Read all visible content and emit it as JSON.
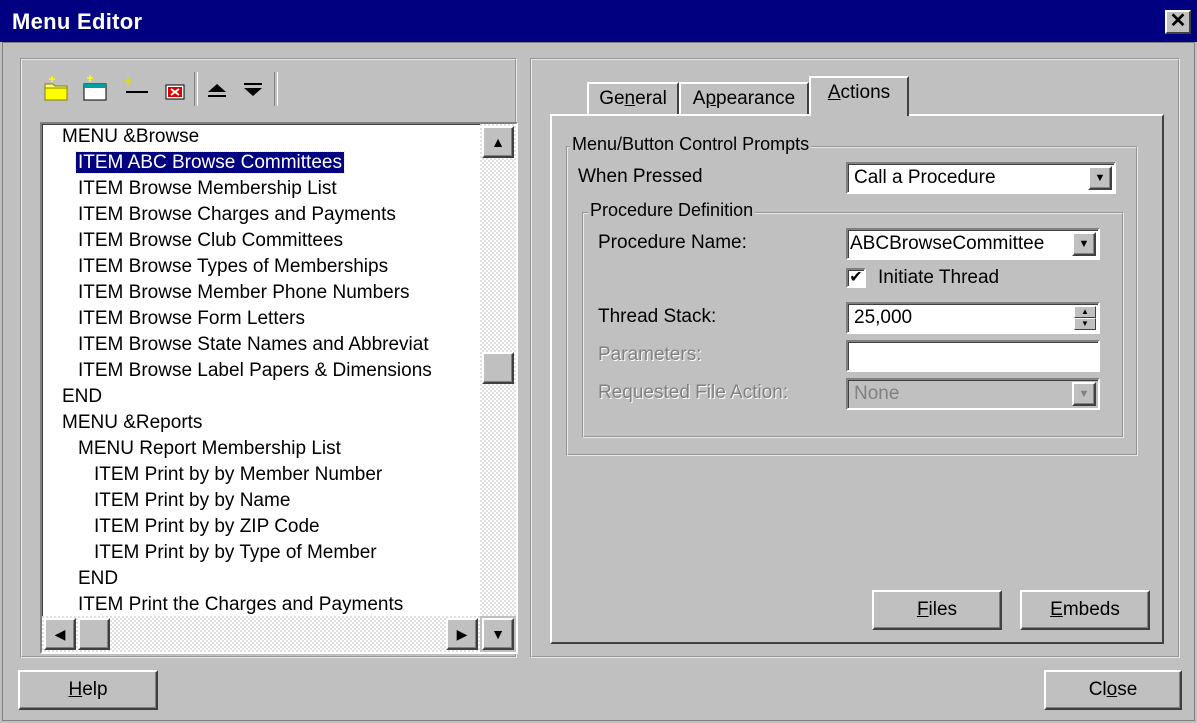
{
  "window": {
    "title": "Menu Editor",
    "close_glyph": "✕"
  },
  "toolbar": {
    "icons": [
      "new-menu-icon",
      "new-item-icon",
      "new-separator-icon",
      "delete-icon",
      "move-up-icon",
      "move-down-icon"
    ]
  },
  "tree": {
    "lines": [
      {
        "indent": 0,
        "text": "MENU  &Browse"
      },
      {
        "indent": 1,
        "text": "ITEM  ABC Browse Committees",
        "selected": true
      },
      {
        "indent": 1,
        "text": "ITEM  Browse Membership List"
      },
      {
        "indent": 1,
        "text": "ITEM  Browse Charges and Payments"
      },
      {
        "indent": 1,
        "text": "ITEM  Browse Club Committees"
      },
      {
        "indent": 1,
        "text": "ITEM  Browse Types of Memberships"
      },
      {
        "indent": 1,
        "text": "ITEM  Browse Member Phone Numbers"
      },
      {
        "indent": 1,
        "text": "ITEM  Browse Form Letters"
      },
      {
        "indent": 1,
        "text": "ITEM  Browse State Names and Abbreviat"
      },
      {
        "indent": 1,
        "text": "ITEM  Browse Label Papers & Dimensions"
      },
      {
        "indent": 0,
        "text": "END"
      },
      {
        "indent": 0,
        "text": "MENU  &Reports"
      },
      {
        "indent": 1,
        "text": "MENU  Report Membership List"
      },
      {
        "indent": 2,
        "text": "ITEM  Print by by Member Number"
      },
      {
        "indent": 2,
        "text": "ITEM  Print by by Name"
      },
      {
        "indent": 2,
        "text": "ITEM  Print by by ZIP Code"
      },
      {
        "indent": 2,
        "text": "ITEM  Print by by Type of Member"
      },
      {
        "indent": 1,
        "text": "END"
      },
      {
        "indent": 1,
        "text": "ITEM  Print the Charges and Payments"
      }
    ]
  },
  "tabs": [
    {
      "pre": "Ge",
      "key": "n",
      "post": "eral"
    },
    {
      "pre": "A",
      "key": "p",
      "post": "pearance"
    },
    {
      "pre": "",
      "key": "A",
      "post": "ctions"
    }
  ],
  "actions": {
    "group_label": "Menu/Button Control Prompts",
    "when_pressed_label": "When Pressed",
    "when_pressed_value": "Call a Procedure",
    "proc_group_label": "Procedure Definition",
    "proc_name_label": "Procedure Name:",
    "proc_name_value": "ABCBrowseCommittee",
    "initiate_thread_label": "Initiate Thread",
    "initiate_thread_checked": true,
    "thread_stack_label": "Thread Stack:",
    "thread_stack_value": "25,000",
    "parameters_label": "Parameters:",
    "parameters_value": "",
    "file_action_label": "Requested File Action:",
    "file_action_value": "None"
  },
  "buttons": {
    "files": {
      "key": "F",
      "post": "iles"
    },
    "embeds": {
      "key": "E",
      "post": "mbeds"
    },
    "help": {
      "key": "H",
      "post": "elp"
    },
    "close": {
      "pre": "Cl",
      "key": "o",
      "post": "se"
    }
  }
}
